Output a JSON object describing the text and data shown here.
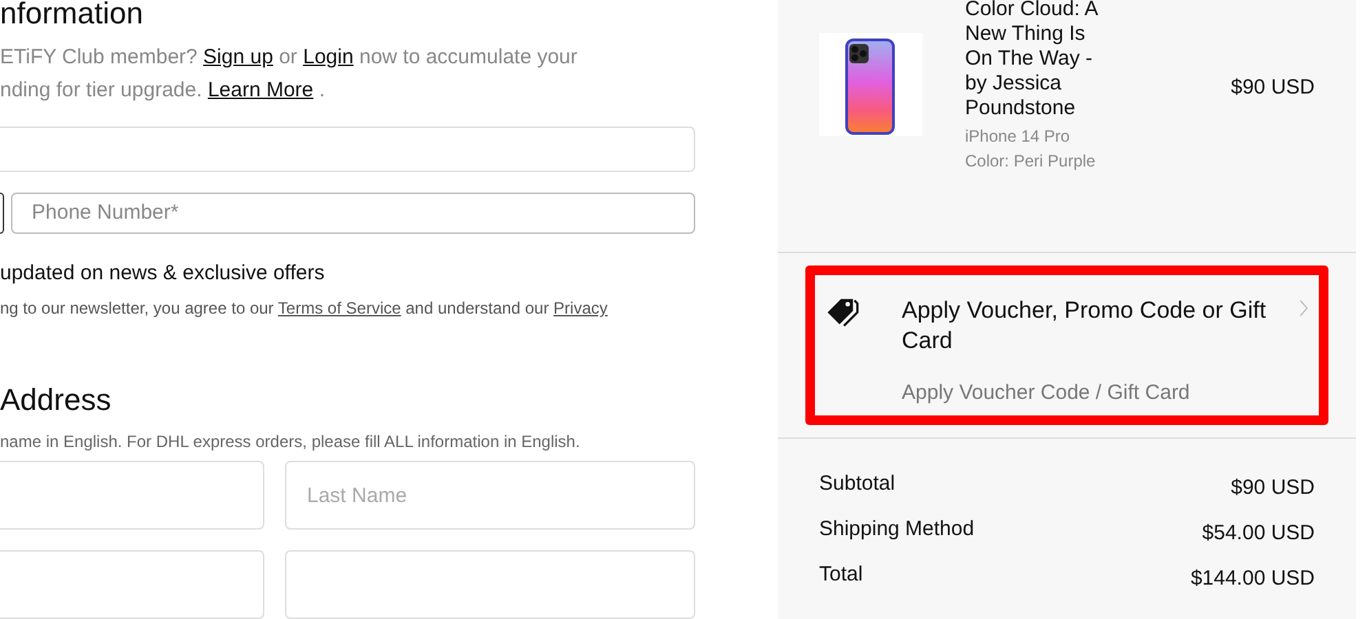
{
  "contact": {
    "heading": "nformation",
    "club_note_lines": [
      [
        {
          "text": "ETiFY Club member? "
        },
        {
          "text": "Sign up",
          "kind": "link"
        },
        {
          "text": " or "
        },
        {
          "text": "Login",
          "kind": "link"
        },
        {
          "text": " now to accumulate your"
        }
      ],
      [
        {
          "text": "nding for tier upgrade. "
        },
        {
          "text": "Learn More",
          "kind": "link"
        },
        {
          "text": " ."
        }
      ]
    ],
    "phone": {
      "placeholder": "Phone Number*"
    },
    "newsletter_label": "updated on news & exclusive offers",
    "legal": [
      {
        "text": "ng to our newsletter, you agree to our "
      },
      {
        "text": "Terms of Service",
        "kind": "link"
      },
      {
        "text": " and understand our "
      },
      {
        "text": "Privacy",
        "kind": "link"
      }
    ]
  },
  "address": {
    "heading": "Address",
    "note": "name in English. For DHL express orders, please fill ALL information in English.",
    "last_name": {
      "placeholder": "Last Name"
    }
  },
  "order": {
    "item": {
      "title": "Color Cloud: A New Thing Is On The Way - by Jessica Poundstone",
      "model": "iPhone 14 Pro",
      "color_option": "Color: Peri Purple",
      "price": "$90 USD"
    },
    "voucher": {
      "title": "Apply Voucher, Promo Code or Gift Card",
      "subtitle": "Apply Voucher Code / Gift Card",
      "highlighted": true
    },
    "summary": [
      {
        "label": "Subtotal",
        "value": "$90 USD"
      },
      {
        "label": "Shipping Method",
        "value": "$54.00 USD"
      },
      {
        "label": "Total",
        "value": "$144.00 USD"
      }
    ]
  }
}
